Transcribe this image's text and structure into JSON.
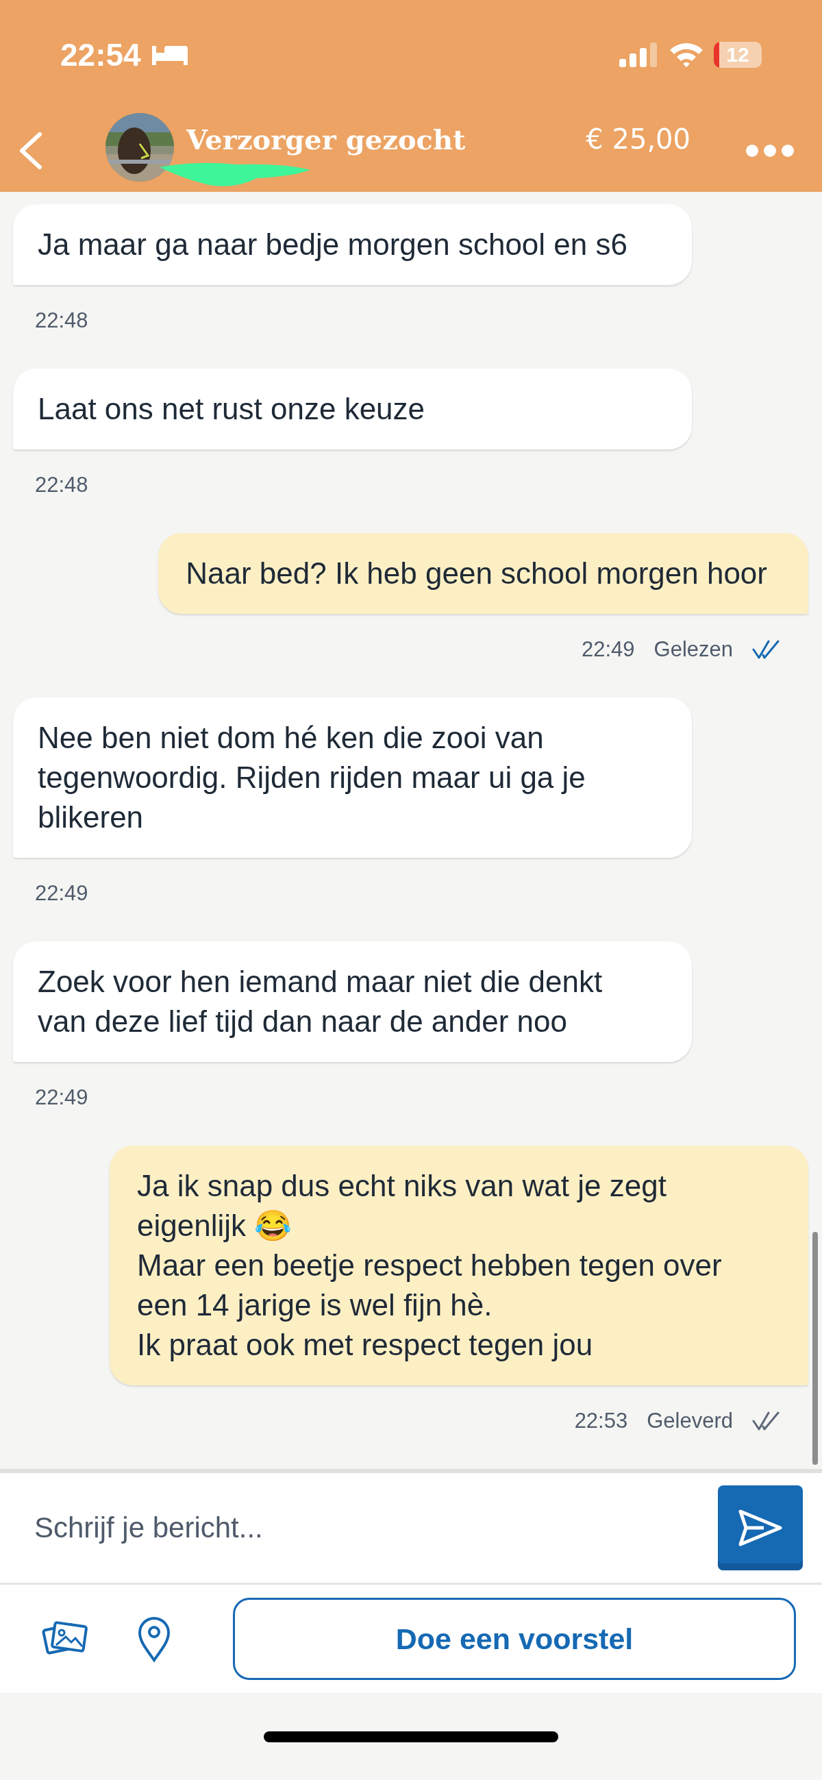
{
  "status_bar": {
    "time": "22:54",
    "battery": "12"
  },
  "header": {
    "title": "Verzorger gezocht",
    "price": "€ 25,00"
  },
  "messages": [
    {
      "kind": "received",
      "text": "Ja maar ga naar bedje morgen school en s6",
      "time": "22:48"
    },
    {
      "kind": "received",
      "text": "Laat ons net rust onze keuze",
      "time": "22:48"
    },
    {
      "kind": "sent",
      "text": "Naar bed? Ik heb geen school morgen hoor",
      "time": "22:49",
      "status": "Gelezen",
      "read": true
    },
    {
      "kind": "received",
      "text": "Nee ben niet dom hé ken die zooi van tegenwoordig. Rijden rijden maar ui ga je blikeren",
      "time": "22:49"
    },
    {
      "kind": "received",
      "text": "Zoek voor hen iemand maar niet die denkt van deze lief tijd dan naar de ander noo",
      "time": "22:49"
    },
    {
      "kind": "sent",
      "text": "Ja ik snap dus echt niks van wat je zegt eigenlijk 😂\nMaar een beetje respect hebben tegen over een 14 jarige is wel fijn hè.\nIk praat ook met respect tegen jou",
      "time": "22:53",
      "status": "Geleverd",
      "read": false
    }
  ],
  "composer": {
    "placeholder": "Schrijf je bericht..."
  },
  "offer_button": "Doe een voorstel"
}
